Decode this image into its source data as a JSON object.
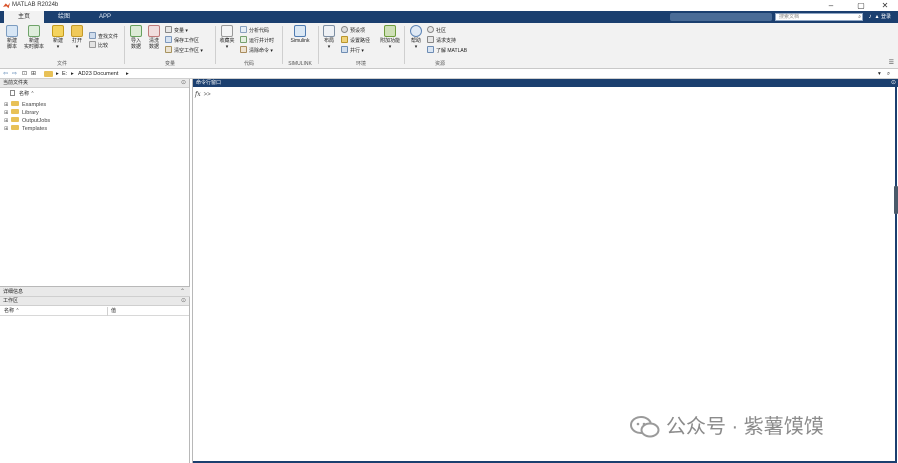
{
  "window": {
    "title": "MATLAB R2024b",
    "controls": [
      "–",
      "▢",
      "✕"
    ]
  },
  "tabs": [
    {
      "label": "主页",
      "active": true
    },
    {
      "label": "绘图",
      "active": false
    },
    {
      "label": "APP",
      "active": false
    }
  ],
  "search": {
    "placeholder": "搜索文档",
    "account_label": "登录"
  },
  "ribbon": {
    "file": {
      "new_script": "新建\n脚本",
      "new_live_script": "新建\n实时脚本",
      "new": "新建",
      "open": "打开",
      "find_files": "查找文件",
      "compare": "比较",
      "group_label": "文件"
    },
    "variable": {
      "import": "导入\n数据",
      "clean": "清洗\n数据",
      "variable": "变量",
      "save_workspace": "保存工作区",
      "clear_workspace": "清空工作区",
      "group_label": "变量"
    },
    "code": {
      "favorites": "收藏夹",
      "analyze": "分析代码",
      "run_time": "运行并计时",
      "clear_commands": "清除命令",
      "group_label": "代码"
    },
    "simulink": {
      "simulink": "Simulink",
      "group_label": "SIMULINK"
    },
    "environment": {
      "layout": "布局",
      "preferences": "预设项",
      "set_path": "设置路径",
      "parallel": "并行",
      "addons": "附加功能",
      "group_label": "环境"
    },
    "resources": {
      "help": "帮助",
      "community": "社区",
      "request_support": "请求支持",
      "learn_matlab": "了解 MATLAB",
      "group_label": "资源"
    }
  },
  "address": {
    "path": [
      "E:",
      "AD23 Document"
    ]
  },
  "current_folder": {
    "title": "当前文件夹",
    "column_name": "名称 ⌃",
    "items": [
      "Examples",
      "Library",
      "OutputJobs",
      "Templates"
    ]
  },
  "details": {
    "title": "详细信息"
  },
  "workspace": {
    "title": "工作区",
    "col_name": "名称 ⌃",
    "col_value": "值"
  },
  "command_window": {
    "title": "命令行窗口",
    "prompt": ">>",
    "fx": "fx"
  },
  "watermark": {
    "text": "公众号 · 紫薯馍馍"
  }
}
